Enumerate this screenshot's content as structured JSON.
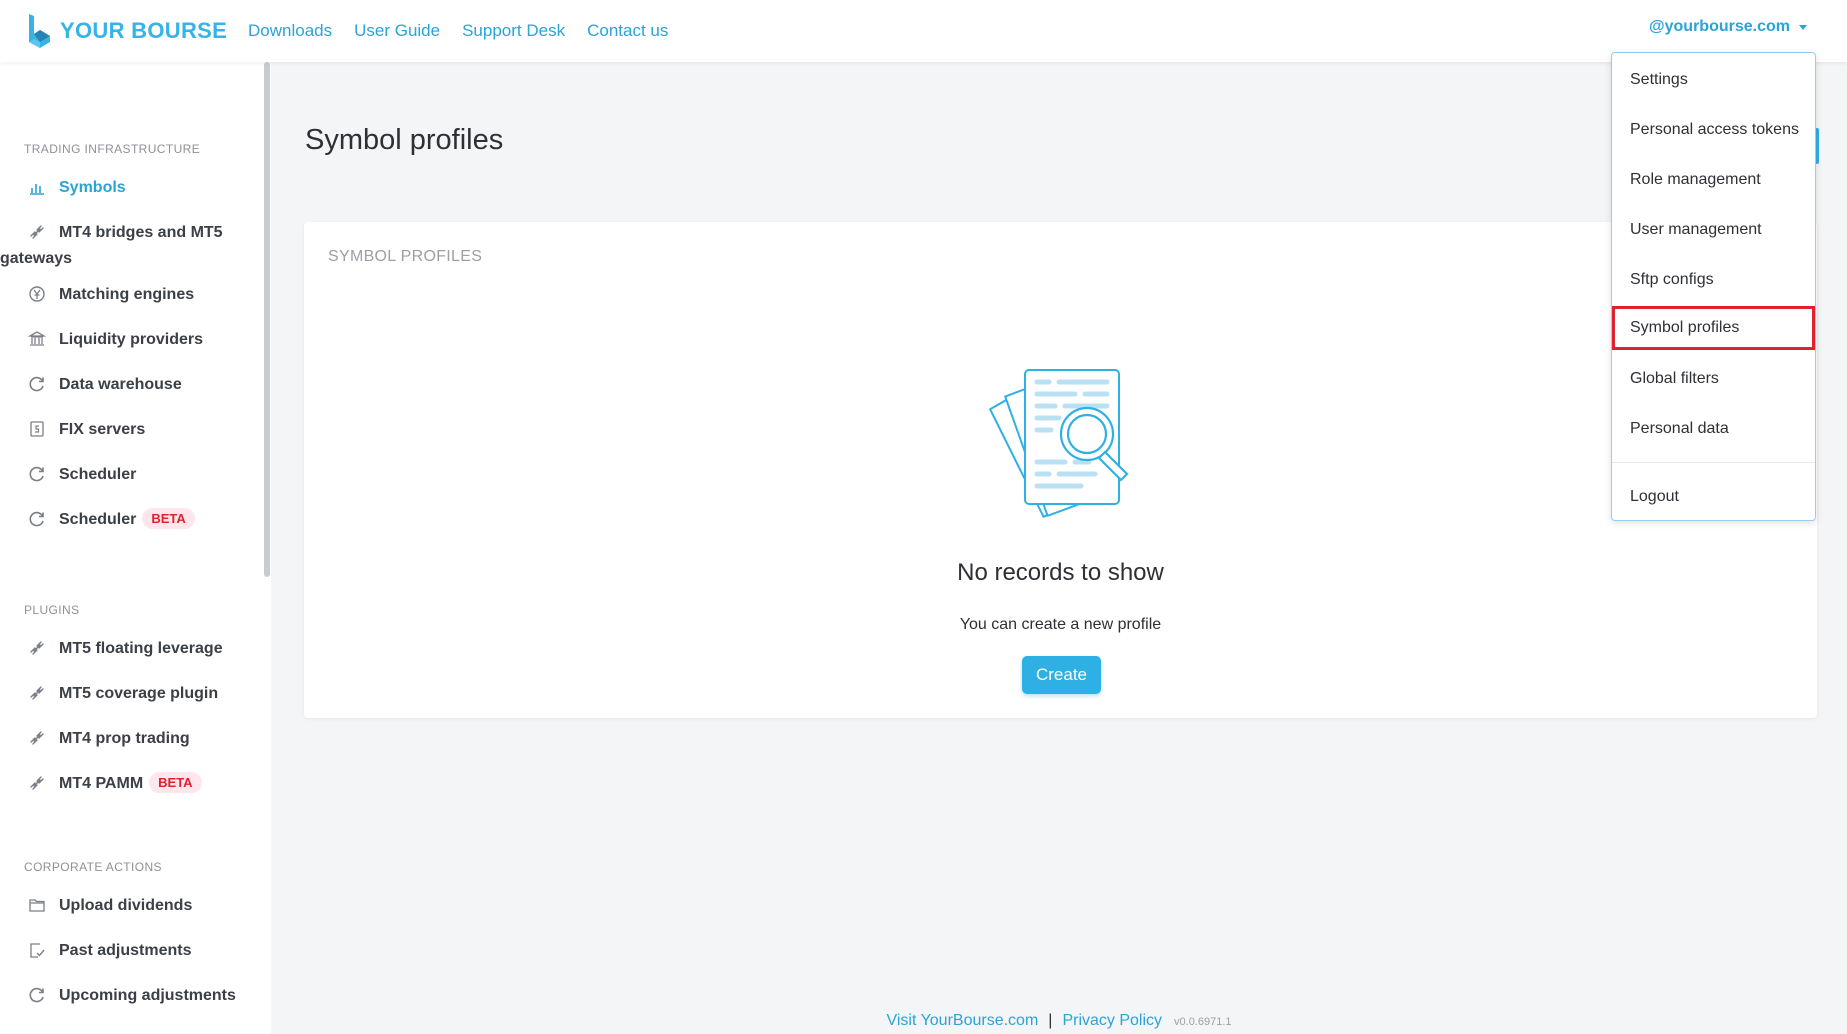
{
  "brand": {
    "name": "YOUR BOURSE"
  },
  "topnav": [
    {
      "label": "Downloads"
    },
    {
      "label": "User Guide"
    },
    {
      "label": "Support Desk"
    },
    {
      "label": "Contact us"
    }
  ],
  "account": {
    "label": "@yourbourse.com"
  },
  "sidebar": {
    "sections": [
      {
        "heading": "TRADING INFRASTRUCTURE",
        "items": [
          {
            "label": "Symbols",
            "icon": "bar-chart-icon",
            "active": true
          },
          {
            "label": "MT4 bridges and MT5",
            "label2": "gateways",
            "icon": "link-icon"
          },
          {
            "label": "Matching engines",
            "icon": "yen-coin-icon"
          },
          {
            "label": "Liquidity providers",
            "icon": "bank-icon"
          },
          {
            "label": "Data warehouse",
            "icon": "refresh-icon"
          },
          {
            "label": "FIX servers",
            "icon": "dollar-doc-icon"
          },
          {
            "label": "Scheduler",
            "icon": "refresh-icon"
          },
          {
            "label": "Scheduler",
            "icon": "refresh-icon",
            "badge": "BETA"
          }
        ]
      },
      {
        "heading": "PLUGINS",
        "items": [
          {
            "label": "MT5 floating leverage",
            "icon": "link-icon"
          },
          {
            "label": "MT5 coverage plugin",
            "icon": "link-icon"
          },
          {
            "label": "MT4 prop trading",
            "icon": "link-icon"
          },
          {
            "label": "MT4 PAMM",
            "icon": "link-icon",
            "badge": "BETA"
          }
        ]
      },
      {
        "heading": "CORPORATE ACTIONS",
        "items": [
          {
            "label": "Upload dividends",
            "icon": "folder-icon"
          },
          {
            "label": "Past adjustments",
            "icon": "check-doc-icon"
          },
          {
            "label": "Upcoming adjustments",
            "icon": "refresh-icon"
          }
        ]
      }
    ]
  },
  "main": {
    "title": "Symbol profiles",
    "card": {
      "heading": "SYMBOL PROFILES",
      "empty_title": "No records to show",
      "empty_subtitle": "You can create a new profile",
      "create_label": "Create",
      "illustration_icon": "documents-magnifier-icon"
    }
  },
  "dropdown": {
    "items": [
      {
        "label": "Settings"
      },
      {
        "label": "Personal access tokens"
      },
      {
        "label": "Role management"
      },
      {
        "label": "User management"
      },
      {
        "label": "Sftp configs"
      },
      {
        "label": "Symbol profiles",
        "highlighted": true
      },
      {
        "label": "Global filters"
      },
      {
        "label": "Personal data"
      },
      {
        "label": "Logout"
      }
    ]
  },
  "footer": {
    "visit_label": "Visit YourBourse.com",
    "separator": "|",
    "privacy_label": "Privacy Policy",
    "version": "v0.0.6971.1"
  },
  "colors": {
    "accent": "#2aa3d7",
    "button": "#2fb0e4",
    "beta_bg": "#fde7ea",
    "beta_text": "#e0212e",
    "highlight_outline": "#e0212e"
  }
}
